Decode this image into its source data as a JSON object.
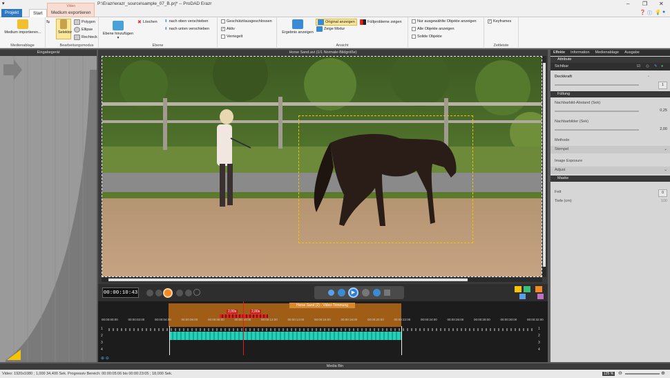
{
  "window": {
    "title": "P:\\Erazr\\erazr_source\\sample_07_B.prj* -- ProDAD Erazr",
    "app_menu": "▾"
  },
  "tabs": {
    "projekt": "Projekt",
    "start": "Start",
    "context_title": "Video",
    "medium_export": "Medium exportieren"
  },
  "ribbon": {
    "medium_import": "Medium importieren...",
    "grp_medienablage": "Medienablage",
    "selektor": "Selektor",
    "polygon": "Polygon",
    "ellipse": "Ellipse",
    "rechteck": "Rechteck",
    "grp_bearbeitungsmodus": "Bearbeitungsmodus",
    "ebene_hinzufuegen": "Ebene hinzufügen",
    "loeschen": "Löschen",
    "nach_oben": "nach oben verschieben",
    "nach_unten": "nach unten verschieben",
    "geschuetzt": "Geschützt/ausgeschlossen",
    "aktiv": "Aktiv",
    "verriegelt": "Verriegelt",
    "grp_ebene": "Ebene",
    "ergebnis": "Ergebnis anzeigen",
    "original": "Original anzeigen",
    "zeige_mixtur": "Zeige Mixtur",
    "fuellprobleme": "Füllprobleme zeigen",
    "grp_ansicht": "Ansicht",
    "nur_ausgewaehlte": "Nur ausgewählte Objekte anzeigen",
    "alle_objekte": "Alle Objekte anzeigen",
    "solide": "Solide Objekte",
    "keyframes": "Keyframes",
    "grp_zeitleiste": "Zeitleiste"
  },
  "left_panel": {
    "title": "Eingabegerät"
  },
  "video": {
    "header": "Horse Sand.avi   (1/1  Normale-Bildgröße)"
  },
  "player": {
    "timecode": "00:00:10:43"
  },
  "timeline": {
    "clip_title": "Horse Sand (2) - Video-Trimmung",
    "marker1": "2,00s",
    "marker2": "2,00s",
    "ruler": [
      "00:00:00:00",
      "00:00:02:00",
      "00:00:04:00",
      "00:00:06:00",
      "00:00:08:00",
      "00:00:10:00",
      "00:00:12:00",
      "00:00:14:00",
      "00:00:16:00",
      "00:00:18:00",
      "00:00:20:00",
      "00:00:22:00",
      "00:00:24:00",
      "00:00:26:00",
      "00:00:28:00",
      "00:00:30:00",
      "00:00:32:00"
    ],
    "tracks": [
      "1",
      "2",
      "3",
      "4"
    ]
  },
  "right_panel": {
    "tab_effekte": "Effekte",
    "tab_information": "Information",
    "tab_medienablage": "Medienablage",
    "tab_ausgabe": "Ausgabe",
    "sect_attribute": "Attribute",
    "sichtbar": "Sichtbar",
    "deckkraft": "Deckkraft",
    "deckkraft_val": "1",
    "sect_fuellung": "Füllung",
    "nachbarbild_abstand": "Nachbarbild-Abstand (Sek)",
    "nachbarbild_abstand_val": "0,25",
    "nachbarbilder": "Nachbarbilder (Sek)",
    "nachbarbilder_val": "2,00",
    "methode": "Methode",
    "methode_val": "Stempel",
    "image_exposure": "Image Exposure",
    "image_exposure_val": "Adjust",
    "sect_maske": "Maske",
    "fett": "Fett",
    "fett_val": "0",
    "tiefe": "Tiefe (cm)",
    "tiefe_val": "100"
  },
  "bottom": {
    "media_bin": "Media Bin",
    "status": "Video: 1920x1080 ; 1,000   34,400 Sek.  Progressiv   Bereich: 00:00:05:06 bis 00:00:23:05 ; 18,000 Sek.",
    "zoom": "125 %"
  }
}
